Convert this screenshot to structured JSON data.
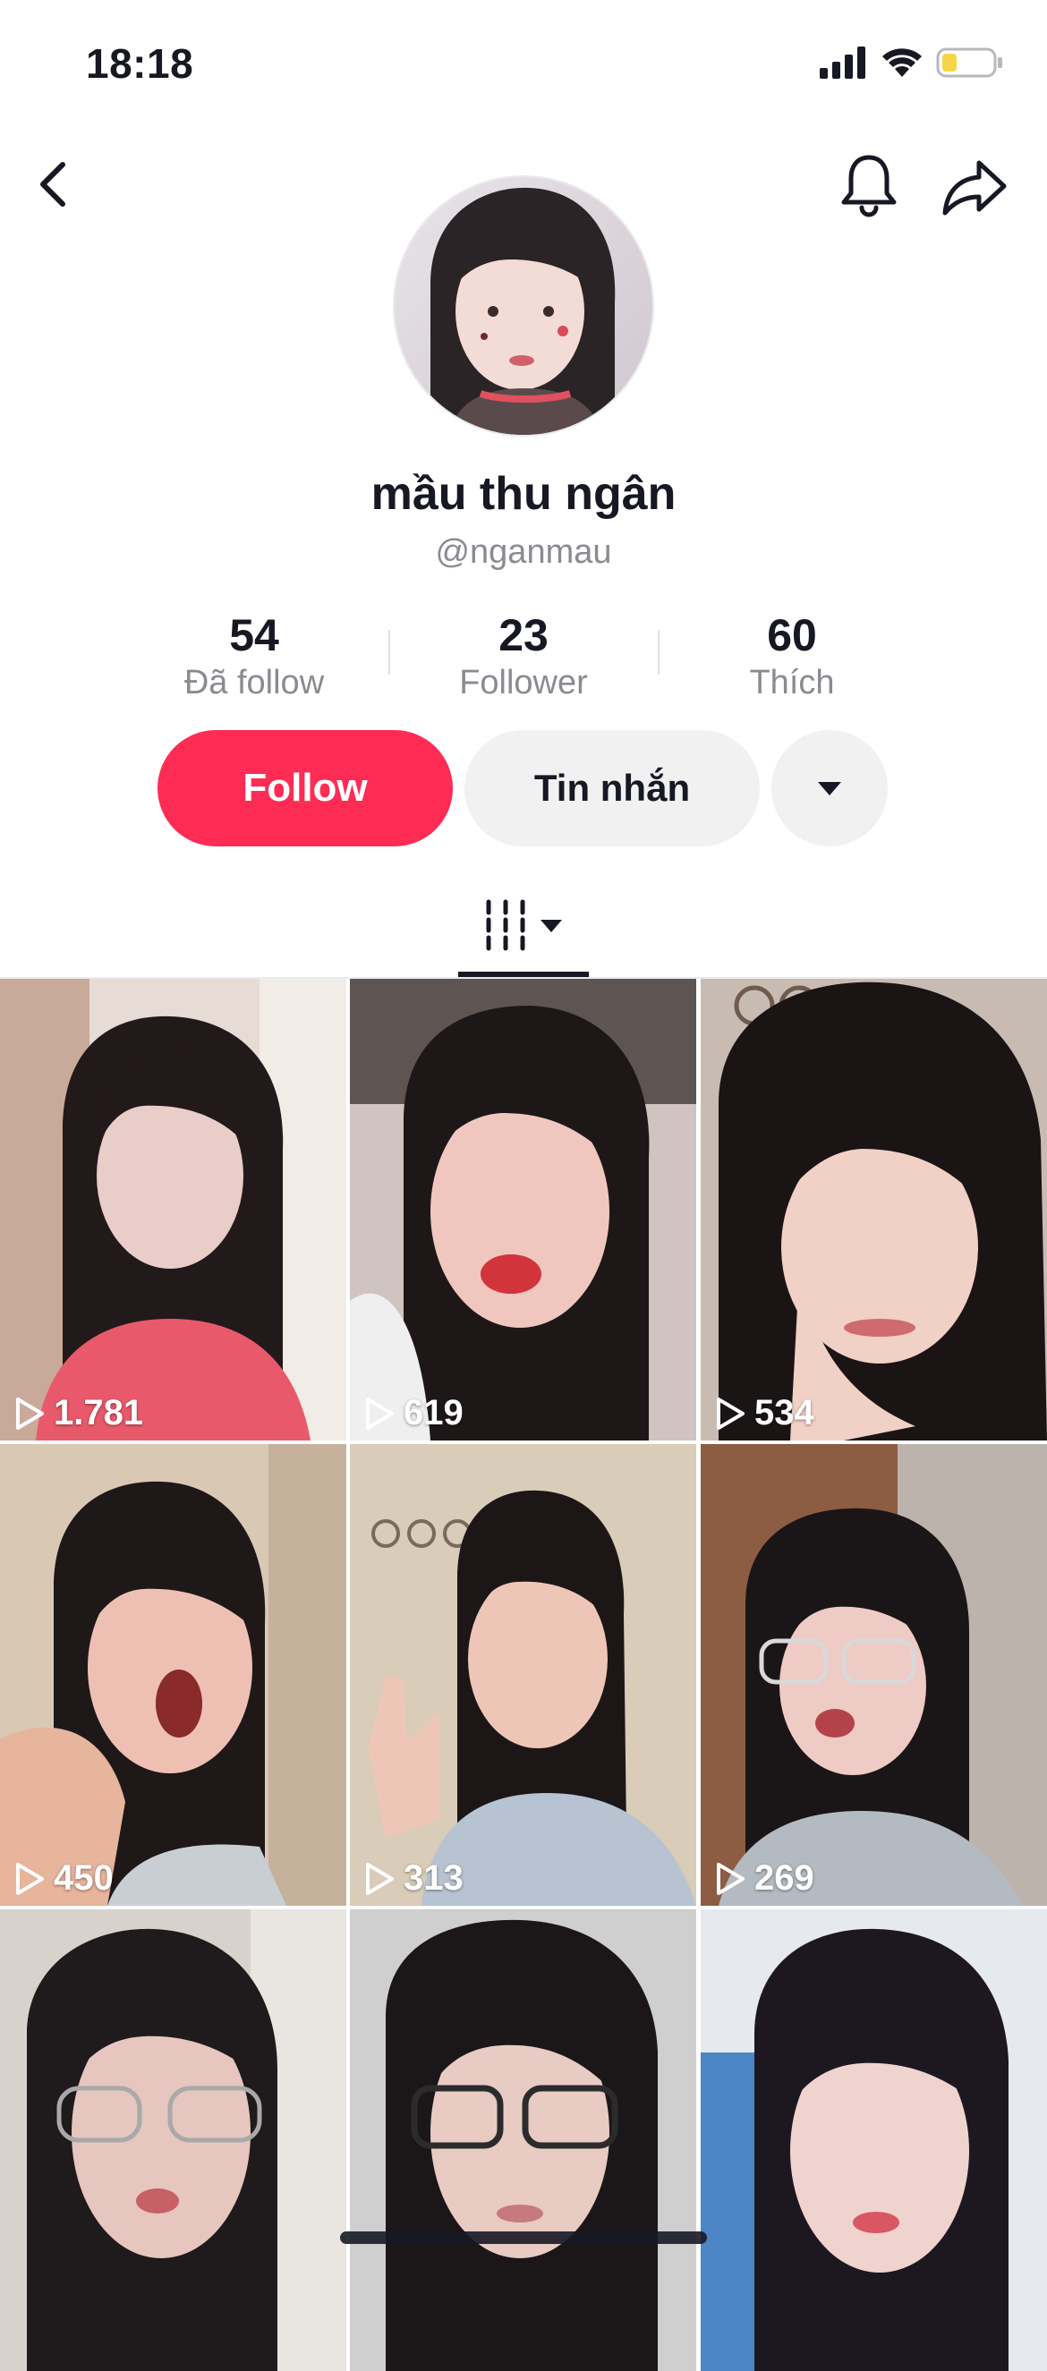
{
  "status_bar": {
    "time": "18:18"
  },
  "profile": {
    "display_name": "mầu thu ngân",
    "username": "@nganmau"
  },
  "stats": [
    {
      "value": "54",
      "label": "Đã follow"
    },
    {
      "value": "23",
      "label": "Follower"
    },
    {
      "value": "60",
      "label": "Thích"
    }
  ],
  "actions": {
    "follow_label": "Follow",
    "message_label": "Tin nhắn"
  },
  "icons": {
    "back": "chevron-left-icon",
    "notification": "bell-icon",
    "share": "share-arrow-icon",
    "more": "caret-down-icon",
    "tab": "grid-icon",
    "views": "play-icon"
  },
  "colors": {
    "accent": "#fe2c55",
    "secondary_button": "#f1f1f2",
    "muted_text": "#8a8b91",
    "battery_level": "#f5d547"
  },
  "videos": [
    {
      "views": "1.781"
    },
    {
      "views": "619"
    },
    {
      "views": "534"
    },
    {
      "views": "450"
    },
    {
      "views": "313"
    },
    {
      "views": "269"
    },
    {
      "views": ""
    },
    {
      "views": ""
    },
    {
      "views": ""
    }
  ]
}
